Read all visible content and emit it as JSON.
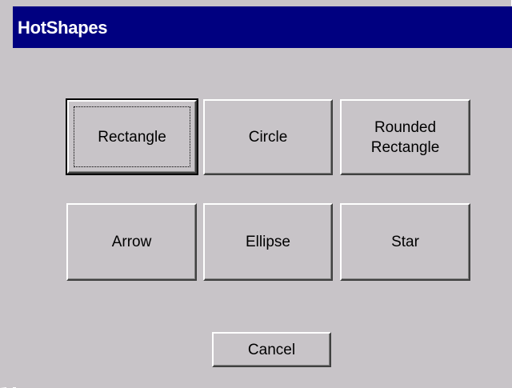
{
  "window": {
    "title": "HotShapes"
  },
  "buttons": {
    "rectangle": "Rectangle",
    "circle": "Circle",
    "rounded_rectangle": "Rounded\nRectangle",
    "arrow": "Arrow",
    "ellipse": "Ellipse",
    "star": "Star",
    "cancel": "Cancel"
  },
  "colors": {
    "titlebar": "#000080",
    "face": "#c8c4c8"
  }
}
